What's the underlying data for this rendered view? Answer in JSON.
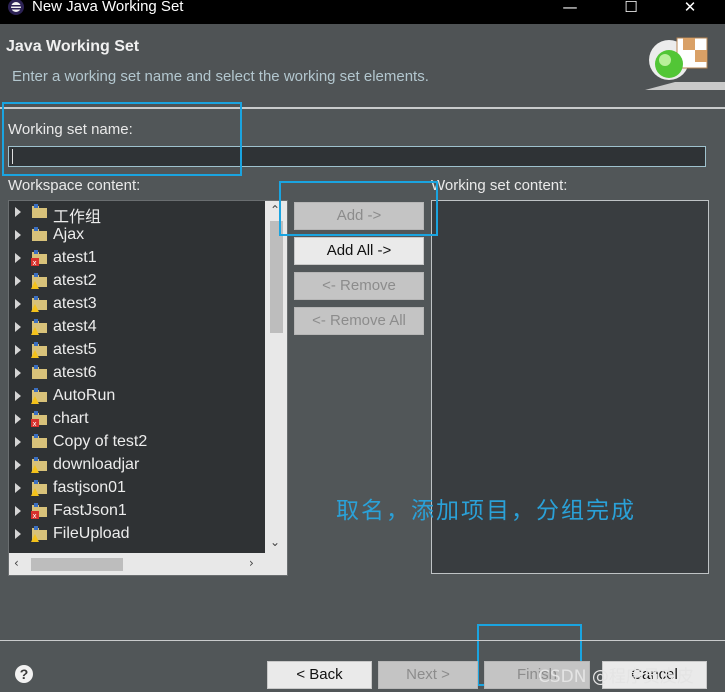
{
  "window": {
    "title": "New Java Working Set",
    "minimize": "—",
    "maximize": "☐",
    "close": "✕"
  },
  "header": {
    "title": "Java Working Set",
    "description": "Enter a working set name and select the working set elements."
  },
  "name_field": {
    "label": "Working set name:",
    "value": ""
  },
  "workspace": {
    "label": "Workspace content:",
    "items": [
      {
        "label": "工作组",
        "icon": "project-folder-icon"
      },
      {
        "label": "Ajax",
        "icon": "project-folder-icon"
      },
      {
        "label": "atest1",
        "icon": "project-error-icon"
      },
      {
        "label": "atest2",
        "icon": "project-warning-icon"
      },
      {
        "label": "atest3",
        "icon": "project-warning-icon"
      },
      {
        "label": "atest4",
        "icon": "project-warning-icon"
      },
      {
        "label": "atest5",
        "icon": "project-warning-icon"
      },
      {
        "label": "atest6",
        "icon": "project-folder-icon"
      },
      {
        "label": "AutoRun",
        "icon": "project-warning-icon"
      },
      {
        "label": "chart",
        "icon": "project-error-icon"
      },
      {
        "label": "Copy of test2",
        "icon": "project-folder-icon"
      },
      {
        "label": "downloadjar",
        "icon": "project-warning-icon"
      },
      {
        "label": "fastjson01",
        "icon": "project-warning-icon"
      },
      {
        "label": "FastJson1",
        "icon": "project-error-icon"
      },
      {
        "label": "FileUpload",
        "icon": "project-warning-icon"
      }
    ]
  },
  "buttons": {
    "add": "Add ->",
    "add_all": "Add All ->",
    "remove": "<- Remove",
    "remove_all": "<- Remove All"
  },
  "working_set": {
    "label": "Working set content:"
  },
  "annotation": "取名，添加项目，分组完成",
  "footer": {
    "help": "?",
    "back": "< Back",
    "next": "Next >",
    "finish": "Finish",
    "cancel": "Cancel"
  },
  "watermark": "CSDN @程序员皮皮",
  "colors": {
    "background": "#515658",
    "tree_background": "#2f3234",
    "annotation": "#2aa1d8",
    "highlight_box": "#1aa4e0"
  }
}
